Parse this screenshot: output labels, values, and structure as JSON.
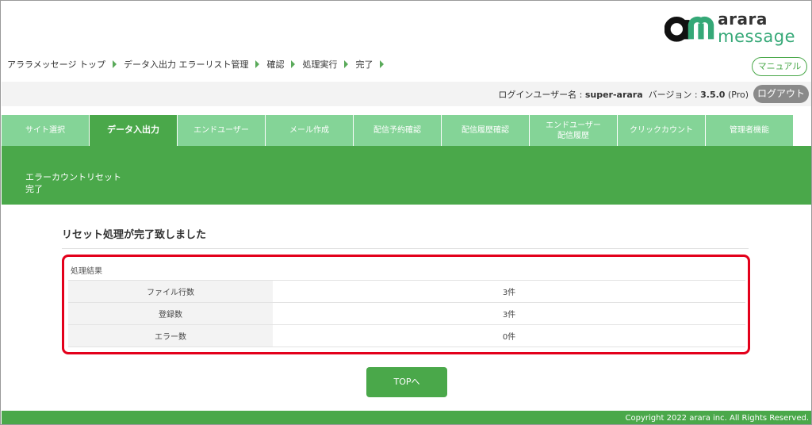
{
  "logo": {
    "mark": "am",
    "line1": "arara",
    "line2": "message"
  },
  "breadcrumb": [
    "アララメッセージ トップ",
    "データ入出力 エラーリスト管理",
    "確認",
    "処理実行",
    "完了"
  ],
  "manual_label": "マニュアル",
  "user": {
    "login_label": "ログインユーザー名 : ",
    "login_name": "super-arara",
    "version_label": "バージョン : ",
    "version": "3.5.0",
    "edition": " (Pro)"
  },
  "logout_label": "ログアウト",
  "tabs": [
    {
      "label": "サイト選択"
    },
    {
      "label": "データ入出力",
      "active": true
    },
    {
      "label": "エンドユーザー"
    },
    {
      "label": "メール作成"
    },
    {
      "label": "配信予約確認"
    },
    {
      "label": "配信履歴確認"
    },
    {
      "label_line1": "エンドユーザー",
      "label_line2": "配信履歴"
    },
    {
      "label": "クリックカウント"
    },
    {
      "label": "管理者機能"
    }
  ],
  "band": {
    "line1": "エラーカウントリセット",
    "line2": "完了"
  },
  "heading": "リセット処理が完了致しました",
  "result": {
    "caption": "処理結果",
    "rows": [
      {
        "key": "ファイル行数",
        "value": "3件"
      },
      {
        "key": "登録数",
        "value": "3件"
      },
      {
        "key": "エラー数",
        "value": "0件"
      }
    ]
  },
  "top_button_label": "TOPへ",
  "footer": "Copyright 2022 arara inc. All Rights Reserved.",
  "colors": {
    "accent": "#4aa84a",
    "tab": "#84d497",
    "highlight": "#e3001b",
    "logo_green": "#35a877"
  }
}
